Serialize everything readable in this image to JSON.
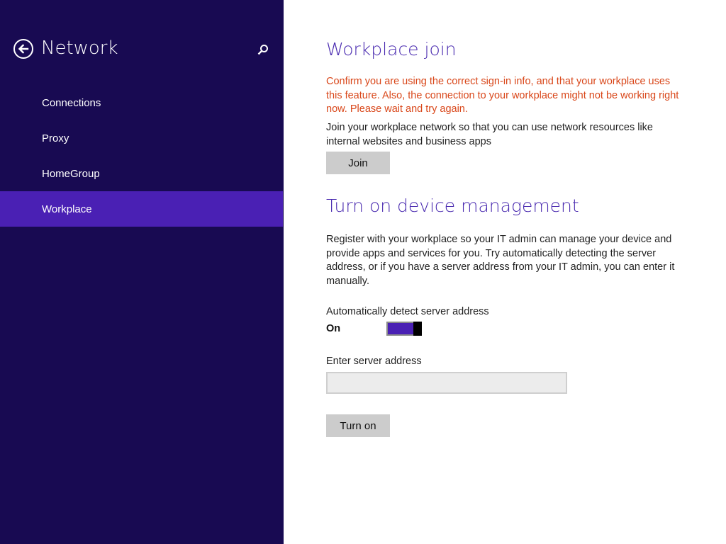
{
  "colors": {
    "sidebar_bg": "#180a52",
    "active_item_bg": "#4a20b4",
    "heading": "#4a2bb0",
    "error_text": "#d9471a",
    "toggle_on": "#4a20b4"
  },
  "sidebar": {
    "back_icon": "back-arrow-icon",
    "title": "Network",
    "search_icon": "search-icon",
    "items": [
      {
        "label": "Connections",
        "active": false
      },
      {
        "label": "Proxy",
        "active": false
      },
      {
        "label": "HomeGroup",
        "active": false
      },
      {
        "label": "Workplace",
        "active": true
      }
    ]
  },
  "workplace_join": {
    "title": "Workplace join",
    "error_message": "Confirm you are using the correct sign-in info, and that your workplace uses this feature. Also, the connection to your workplace might not be working right now. Please wait and try again.",
    "description": "Join your workplace network so that you can use network resources like internal websites and business apps",
    "join_label": "Join"
  },
  "device_management": {
    "title": "Turn on device management",
    "description": "Register with your workplace so your IT admin can manage your device and provide apps and services for you. Try automatically detecting the server address, or if you have a server address from your IT admin, you can enter it manually.",
    "auto_detect_label": "Automatically detect server address",
    "auto_detect_state": "On",
    "auto_detect_on": true,
    "server_address_label": "Enter server address",
    "server_address_value": "",
    "server_address_placeholder": "",
    "turn_on_label": "Turn on"
  }
}
